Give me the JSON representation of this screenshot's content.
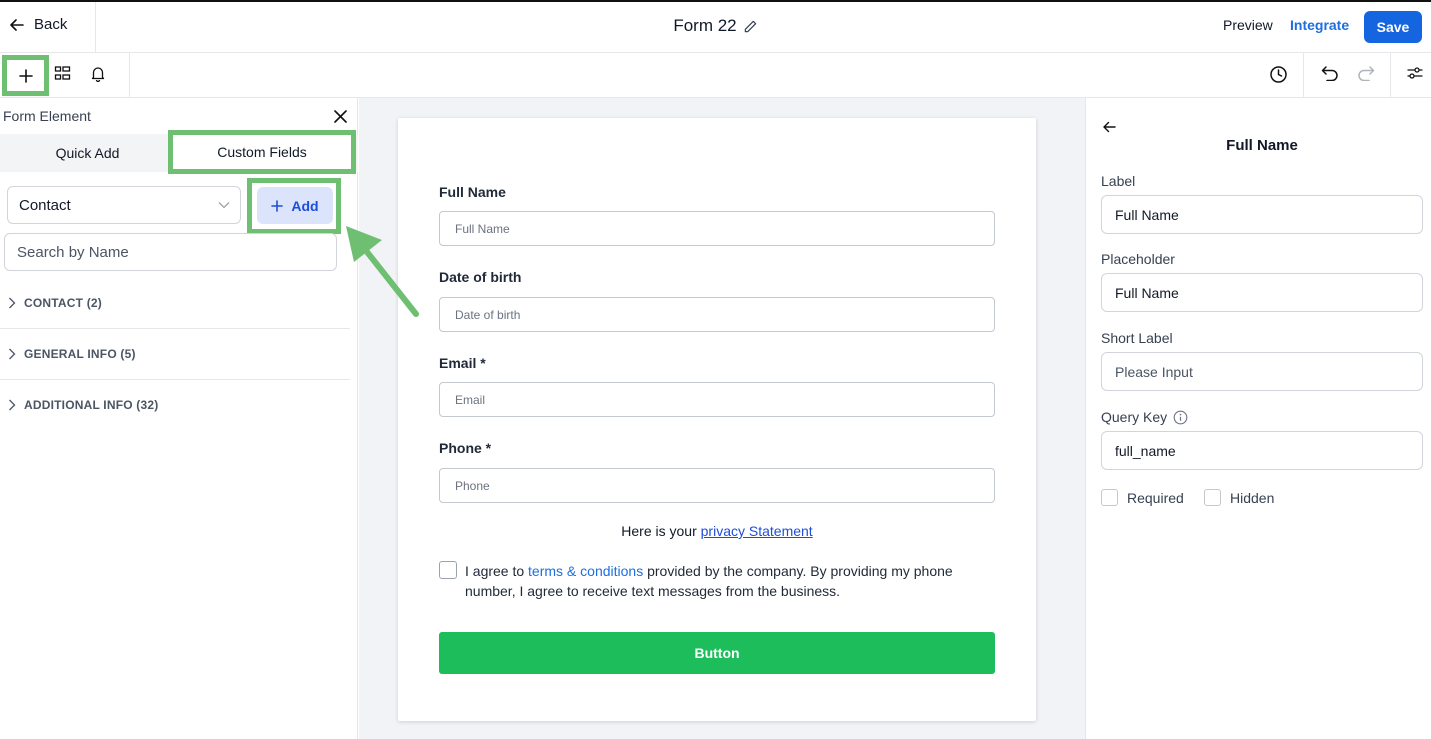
{
  "header": {
    "back_label": "Back",
    "form_title": "Form 22",
    "preview_label": "Preview",
    "integrate_label": "Integrate",
    "save_label": "Save"
  },
  "left_panel": {
    "title": "Form Element",
    "tabs": [
      {
        "label": "Quick Add"
      },
      {
        "label": "Custom Fields"
      }
    ],
    "object_select": "Contact",
    "add_label": "Add",
    "search_placeholder": "Search by Name",
    "groups": [
      {
        "label": "CONTACT (2)"
      },
      {
        "label": "GENERAL INFO (5)"
      },
      {
        "label": "ADDITIONAL INFO (32)"
      }
    ]
  },
  "form": {
    "fields": [
      {
        "label": "Full Name",
        "placeholder": "Full Name"
      },
      {
        "label": "Date of birth",
        "placeholder": "Date of birth"
      },
      {
        "label": "Email *",
        "placeholder": "Email"
      },
      {
        "label": "Phone *",
        "placeholder": "Phone"
      }
    ],
    "privacy_prefix": "Here is your ",
    "privacy_link": "privacy Statement",
    "agree_prefix": "I agree to ",
    "agree_link": "terms & conditions",
    "agree_suffix": " provided by the company. By providing my phone number, I agree to receive text messages from the business.",
    "button_label": "Button"
  },
  "properties": {
    "title": "Full Name",
    "label_caption": "Label",
    "label_value": "Full Name",
    "placeholder_caption": "Placeholder",
    "placeholder_value": "Full Name",
    "short_label_caption": "Short Label",
    "short_label_placeholder": "Please Input",
    "query_key_caption": "Query Key",
    "query_key_value": "full_name",
    "required_label": "Required",
    "hidden_label": "Hidden"
  },
  "colors": {
    "primary": "#1565e0",
    "highlight": "#6fbf73",
    "submit": "#1ebd5b",
    "link": "#1d6fe0"
  }
}
